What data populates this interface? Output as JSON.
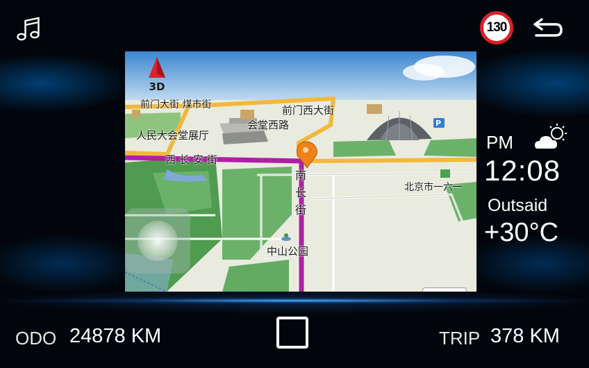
{
  "header": {
    "music_icon": "music-note-icon",
    "speed_limit": "130",
    "speed_limit_color": "#d8202a",
    "back_icon": "return-arrow-icon"
  },
  "map": {
    "compass_mode": "3D",
    "labels": {
      "qianmen_street": "前门西大街",
      "great_hall": "人民大会堂展厅",
      "huitang_road": "会堂西路",
      "west_changan": "西长安街",
      "south_changjie": "南长街",
      "beijing_no1": "北京市一六一",
      "zhongshan_park": "中山公园",
      "top_truncated": "前门大街 煤市街"
    },
    "route_color": "#b01ea8"
  },
  "status": {
    "ampm": "PM",
    "time": "12:08",
    "weather_icon": "partly-cloudy-sun-icon",
    "outside_label": "Outsaid",
    "temperature": "+30°C"
  },
  "footer": {
    "odo_label": "ODO",
    "odo_value": "24878 KM",
    "trip_label": "TRIP",
    "trip_value": "378 KM",
    "home_icon": "home-square-icon"
  }
}
